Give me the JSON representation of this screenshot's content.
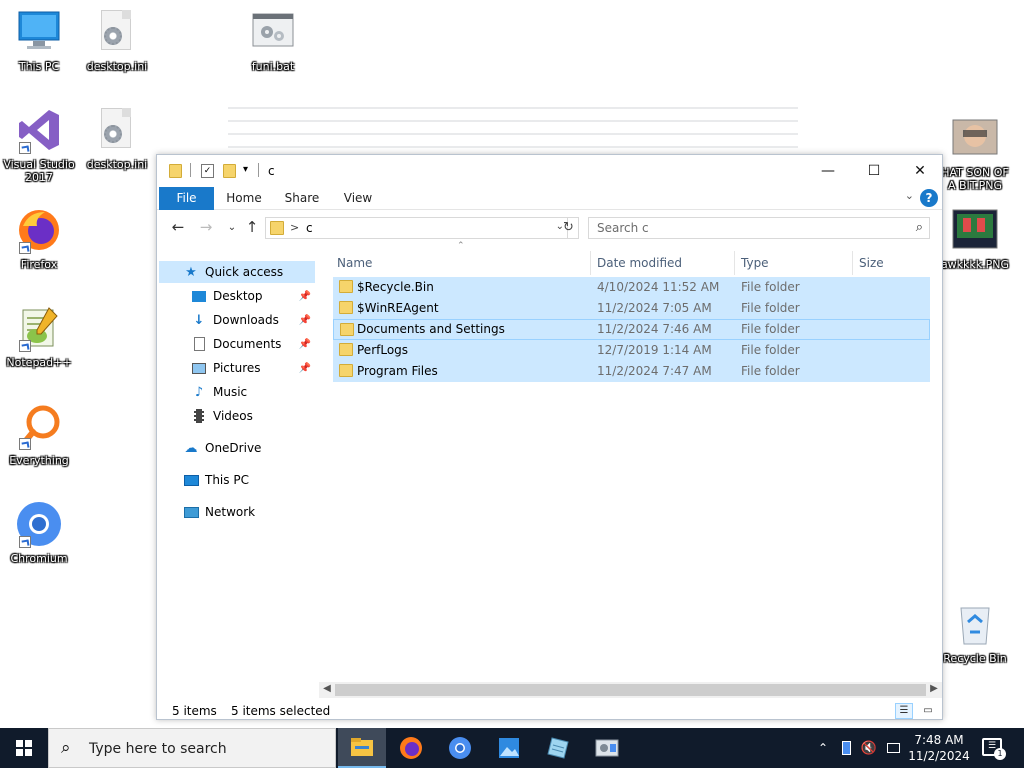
{
  "desktop": {
    "icons": [
      {
        "label": "This PC",
        "icon": "monitor-icon"
      },
      {
        "label": "desktop.ini",
        "icon": "config-file-icon"
      },
      {
        "label": "funi.bat",
        "icon": "batch-file-icon"
      },
      {
        "label": "Visual Studio 2017",
        "icon": "visual-studio-icon"
      },
      {
        "label": "desktop.ini",
        "icon": "config-file-icon"
      },
      {
        "label": "Firefox",
        "icon": "firefox-icon"
      },
      {
        "label": "Notepad++",
        "icon": "notepadpp-icon"
      },
      {
        "label": "Everything",
        "icon": "search-magnifier-icon"
      },
      {
        "label": "Chromium",
        "icon": "chromium-icon"
      },
      {
        "label": "HAT SON OF A BIT.PNG",
        "icon": "image-file-icon"
      },
      {
        "label": "awkkkk.PNG",
        "icon": "image-file-icon"
      },
      {
        "label": "Recycle Bin",
        "icon": "recycle-bin-icon"
      }
    ]
  },
  "explorer": {
    "title": "c",
    "window_controls": {
      "minimize": "—",
      "maximize": "☐",
      "close": "✕"
    },
    "ribbon_tabs": [
      "File",
      "Home",
      "Share",
      "View"
    ],
    "help_label": "?",
    "address": {
      "path": "c",
      "separator": ">"
    },
    "search": {
      "placeholder": "Search c"
    },
    "nav": {
      "quick_access": "Quick access",
      "items": [
        {
          "label": "Desktop",
          "pinned": true
        },
        {
          "label": "Downloads",
          "pinned": true
        },
        {
          "label": "Documents",
          "pinned": true
        },
        {
          "label": "Pictures",
          "pinned": true
        },
        {
          "label": "Music",
          "pinned": false
        },
        {
          "label": "Videos",
          "pinned": false
        }
      ],
      "onedrive": "OneDrive",
      "this_pc": "This PC",
      "network": "Network"
    },
    "columns": {
      "name": "Name",
      "date": "Date modified",
      "type": "Type",
      "size": "Size"
    },
    "rows": [
      {
        "name": "$Recycle.Bin",
        "date": "4/10/2024 11:52 AM",
        "type": "File folder"
      },
      {
        "name": "$WinREAgent",
        "date": "11/2/2024 7:05 AM",
        "type": "File folder"
      },
      {
        "name": "Documents and Settings",
        "date": "11/2/2024 7:46 AM",
        "type": "File folder"
      },
      {
        "name": "PerfLogs",
        "date": "12/7/2019 1:14 AM",
        "type": "File folder"
      },
      {
        "name": "Program Files",
        "date": "11/2/2024 7:47 AM",
        "type": "File folder"
      }
    ],
    "status": {
      "count": "5 items",
      "selected": "5 items selected"
    }
  },
  "taskbar": {
    "search_placeholder": "Type here to search",
    "apps": [
      "file-explorer-icon",
      "firefox-icon",
      "chromium-icon",
      "photos-icon",
      "notepad-icon",
      "control-panel-icon"
    ],
    "clock": {
      "time": "7:48 AM",
      "date": "11/2/2024"
    },
    "notification_count": "1"
  },
  "colors": {
    "accent": "#1979ca",
    "selection": "#cce8ff",
    "taskbar": "#101b2b",
    "folder": "#f6d46b"
  }
}
